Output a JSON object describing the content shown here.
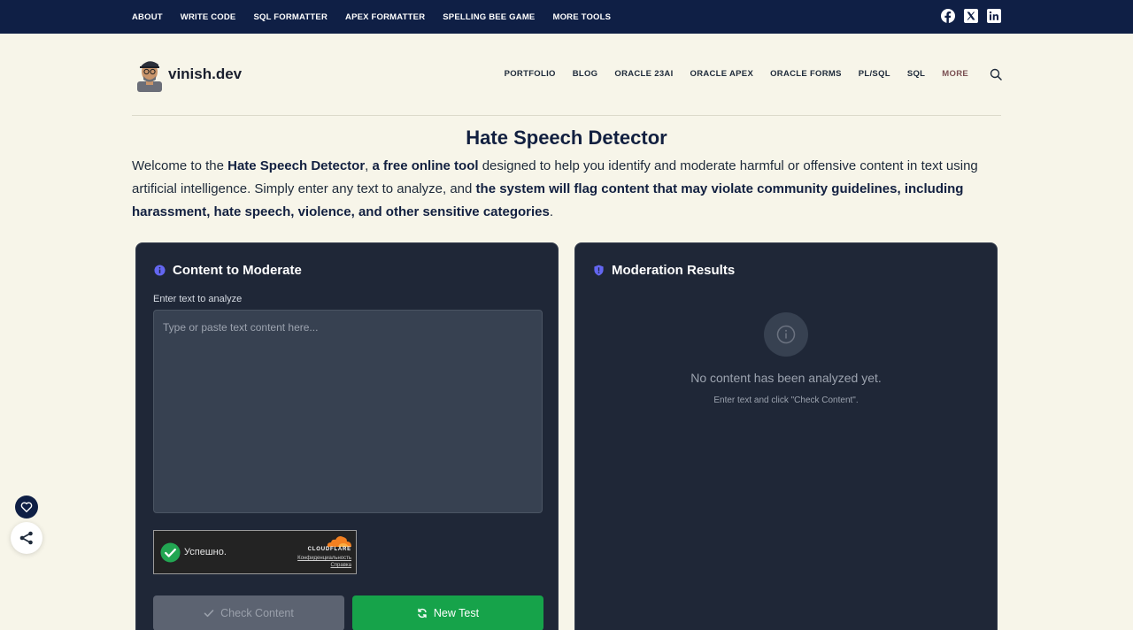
{
  "topbar": {
    "links": [
      "ABOUT",
      "WRITE CODE",
      "SQL FORMATTER",
      "APEX FORMATTER",
      "SPELLING BEE GAME",
      "MORE TOOLS"
    ],
    "social_icons": [
      "facebook-icon",
      "x-icon",
      "linkedin-icon"
    ]
  },
  "header": {
    "brand": "vinish.dev",
    "nav": [
      "PORTFOLIO",
      "BLOG",
      "ORACLE 23AI",
      "ORACLE APEX",
      "ORACLE FORMS",
      "PL/SQL",
      "SQL",
      "MORE"
    ]
  },
  "page": {
    "title": "Hate Speech Detector",
    "intro": {
      "p1": "Welcome to the ",
      "b1": "Hate Speech Detector",
      "p2": ", ",
      "b2": "a free online tool",
      "p3": " designed to help you identify and moderate harmful or offensive content in text using artificial intelligence. Simply enter any text to analyze, and ",
      "b3": "the system will flag content that may violate community guidelines, including harassment, hate speech, violence, and other sensitive categories",
      "p4": "."
    }
  },
  "input_panel": {
    "title": "Content to Moderate",
    "field_label": "Enter text to analyze",
    "placeholder": "Type or paste text content here...",
    "value": "",
    "captcha": {
      "status": "Успешно.",
      "brand": "CLOUDFLARE",
      "privacy_link": "Конфиденциальность",
      "help_link": "Справка"
    },
    "check_button": "Check Content",
    "new_test_button": "New Test"
  },
  "results_panel": {
    "title": "Moderation Results",
    "empty_title": "No content has been analyzed yet.",
    "empty_subtitle": "Enter text and click \"Check Content\"."
  },
  "colors": {
    "topbar": "#0f1f45",
    "page_bg": "#f7f5e9",
    "panel_bg": "#1f2737",
    "accent_purple": "#6366f1",
    "success_green": "#16a34a",
    "more_link": "#7a4f52"
  }
}
